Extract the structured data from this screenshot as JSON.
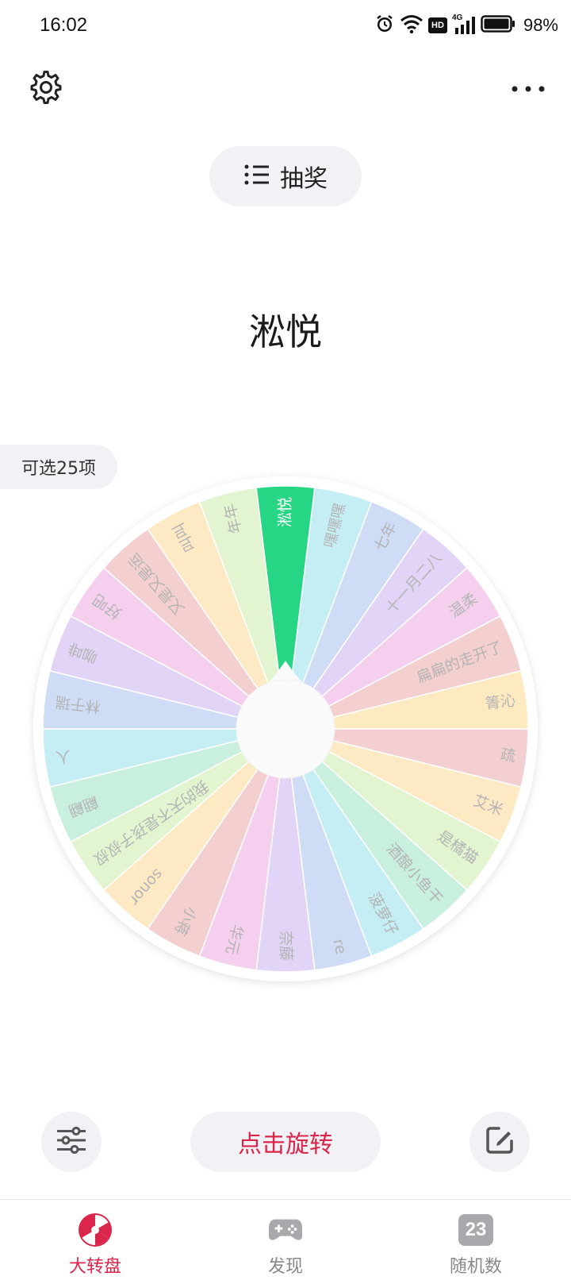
{
  "status_bar": {
    "time": "16:02",
    "battery": "98%",
    "network": "4G",
    "hd": "HD"
  },
  "mode_chip": {
    "label": "抽奖"
  },
  "result": {
    "text": "淞悦"
  },
  "count_chip": {
    "text": "可选25项"
  },
  "wheel": {
    "items": [
      "淞悦",
      "嘿嘿嘿",
      "七年",
      "十一月二八",
      "温柔",
      "扁扁的走开了",
      "箐沁",
      "疏",
      "艾米",
      "是橘猫",
      "酒酿小鱼干",
      "菠萝仔",
      "re",
      "奈藤",
      "华元",
      "小蒋",
      "sonor",
      "我的天不是孩子叔叔",
      "翩翩",
      "人",
      "林于瑞",
      "咖啡",
      "好吧",
      "又是又是运",
      "叫叫",
      "年年"
    ],
    "colors": [
      "#26d684",
      "#c5eef4",
      "#cfdcf6",
      "#e2d4f6",
      "#f4d0ee",
      "#f4cfd0",
      "#fdeac0",
      "#f4cfd2",
      "#fde9c4",
      "#e2f4d0",
      "#c9f0de",
      "#c5eef4",
      "#cfdcf6",
      "#e2d4f6",
      "#f4d0ee",
      "#f4cfd0",
      "#fde9c4",
      "#e2f4d0",
      "#c9f0de",
      "#c5eef4",
      "#cfdcf6",
      "#e2d4f6",
      "#f4d0ee",
      "#f4cfd0",
      "#fde9c4",
      "#e2f4d0"
    ],
    "selected_index": 0,
    "selected_text_color": "#ffffff",
    "text_color": "#b4b4b4"
  },
  "controls": {
    "spin_label": "点击旋转",
    "accent": "#d9264a"
  },
  "tabs": [
    {
      "label": "大转盘",
      "icon": "wheel-icon",
      "active": true
    },
    {
      "label": "发现",
      "icon": "gamepad-icon",
      "active": false
    },
    {
      "label": "随机数",
      "icon": "calendar-icon",
      "badge": "23",
      "active": false
    }
  ]
}
